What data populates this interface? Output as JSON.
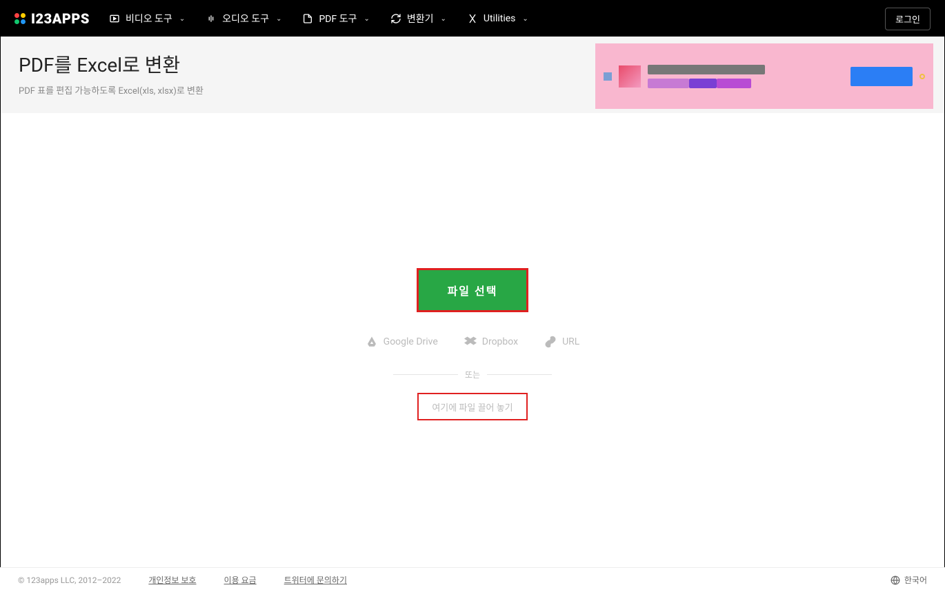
{
  "brand": "I23APPS",
  "nav": {
    "items": [
      {
        "label": "비디오 도구"
      },
      {
        "label": "오디오 도구"
      },
      {
        "label": "PDF 도구"
      },
      {
        "label": "변환기"
      },
      {
        "label": "Utilities"
      }
    ],
    "login": "로그인"
  },
  "header": {
    "title": "PDF를 Excel로 변환",
    "subtitle": "PDF 표를 편집 가능하도록 Excel(xls, xlsx)로 변환"
  },
  "main": {
    "select_file": "파일 선택",
    "sources": {
      "gdrive": "Google Drive",
      "dropbox": "Dropbox",
      "url": "URL"
    },
    "or": "또는",
    "dropzone": "여기에 파일 끌어 놓기"
  },
  "footer": {
    "copyright": "© 123apps LLC, 2012–2022",
    "links": [
      "개인정보 보호",
      "이용 요금",
      "트위터에 문의하기"
    ],
    "language": "한국어"
  }
}
